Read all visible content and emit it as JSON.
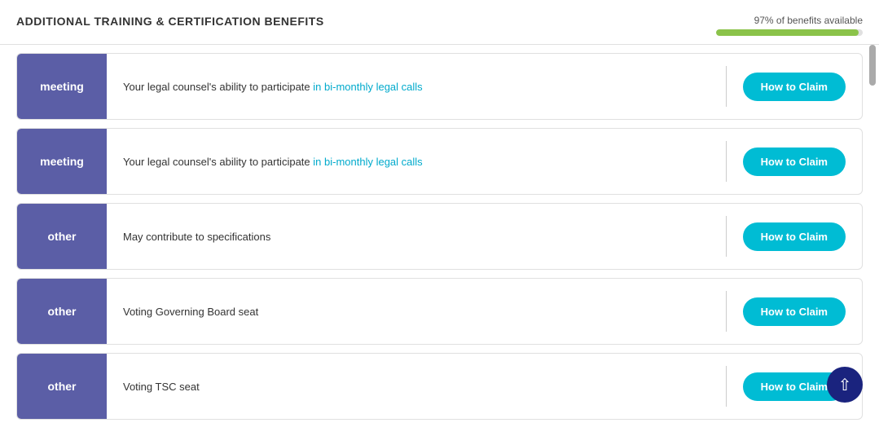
{
  "header": {
    "title": "ADDITIONAL TRAINING & CERTIFICATION BENEFITS",
    "benefits_text": "97% of benefits available",
    "progress_percent": 97
  },
  "rows": [
    {
      "tag": "meeting",
      "tag_type": "meeting",
      "description_parts": [
        {
          "text": "Your legal counsel's ability to participate ",
          "highlight": false
        },
        {
          "text": "in bi-monthly legal calls",
          "highlight": true
        }
      ],
      "description_full": "Your legal counsel's ability to participate in bi-monthly legal calls",
      "btn_label": "How to Claim"
    },
    {
      "tag": "meeting",
      "tag_type": "meeting",
      "description_parts": [
        {
          "text": "Your legal counsel's ability to participate ",
          "highlight": false
        },
        {
          "text": "in bi-monthly legal calls",
          "highlight": true
        }
      ],
      "description_full": "Your legal counsel's ability to participate in bi-monthly legal calls",
      "btn_label": "How to Claim"
    },
    {
      "tag": "other",
      "tag_type": "other",
      "description_full": "May contribute to specifications",
      "btn_label": "How to Claim"
    },
    {
      "tag": "other",
      "tag_type": "other",
      "description_full": "Voting Governing Board seat",
      "btn_label": "How to Claim"
    },
    {
      "tag": "other",
      "tag_type": "other",
      "description_full": "Voting TSC seat",
      "btn_label": "How to Claim"
    }
  ],
  "back_to_top_label": "↑"
}
